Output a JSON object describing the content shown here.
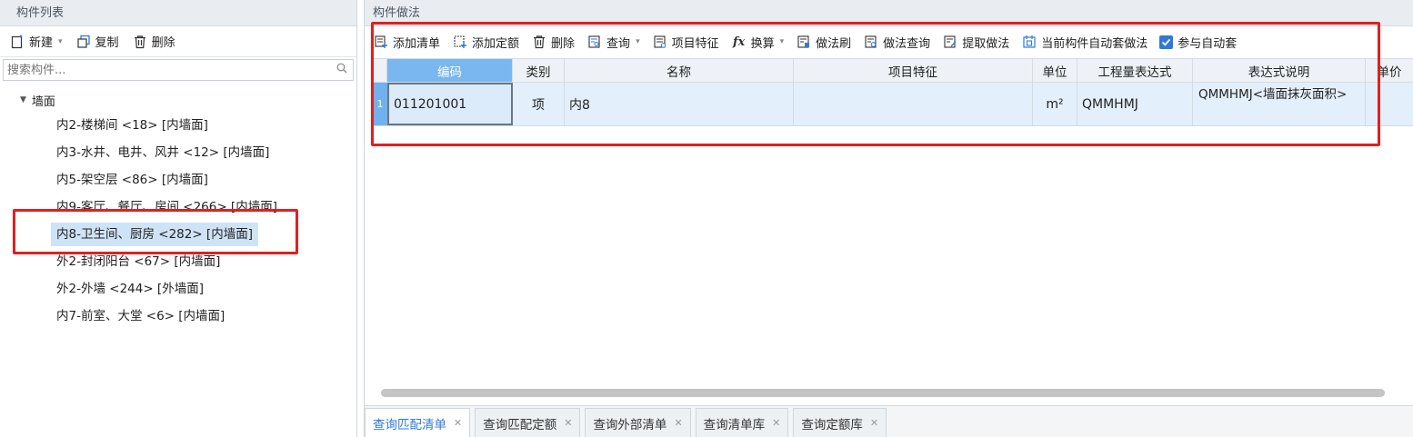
{
  "left_panel": {
    "title": "构件列表",
    "toolbar": {
      "new_label": "新建",
      "copy_label": "复制",
      "delete_label": "删除"
    },
    "search": {
      "placeholder": "搜索构件..."
    },
    "tree": {
      "root_label": "墙面",
      "items": [
        {
          "label": "内2-楼梯间 <18> [内墙面]"
        },
        {
          "label": "内3-水井、电井、风井 <12> [内墙面]"
        },
        {
          "label": "内5-架空层 <86> [内墙面]"
        },
        {
          "label": "内9-客厅、餐厅、房间 <266> [内墙面]"
        },
        {
          "label": "内8-卫生间、厨房 <282> [内墙面]",
          "selected": true
        },
        {
          "label": "外2-封闭阳台 <67> [内墙面]"
        },
        {
          "label": "外2-外墙 <244> [外墙面]"
        },
        {
          "label": "内7-前室、大堂 <6> [内墙面]"
        }
      ]
    }
  },
  "right_panel": {
    "title": "构件做法",
    "toolbar": {
      "add_list": "添加清单",
      "add_quota": "添加定额",
      "delete": "删除",
      "query": "查询",
      "item_feature": "项目特征",
      "convert": "换算",
      "method_brush": "做法刷",
      "method_query": "做法查询",
      "extract_method": "提取做法",
      "auto_apply": "当前构件自动套做法",
      "participate_auto": "参与自动套"
    },
    "grid": {
      "columns": [
        "编码",
        "类别",
        "名称",
        "项目特征",
        "单位",
        "工程量表达式",
        "表达式说明",
        "单价"
      ],
      "rows": [
        {
          "num": "1",
          "code": "011201001",
          "category": "项",
          "name": "内8",
          "feature": "",
          "unit": "m²",
          "expression": "QMMHMJ",
          "expr_desc": "QMMHMJ<墙面抹灰面积>",
          "price": ""
        }
      ]
    },
    "bottom_tabs": [
      {
        "label": "查询匹配清单",
        "active": true
      },
      {
        "label": "查询匹配定额"
      },
      {
        "label": "查询外部清单"
      },
      {
        "label": "查询清单库"
      },
      {
        "label": "查询定额库"
      }
    ]
  },
  "colors": {
    "selection_blue": "#cfe3f6",
    "header_active": "#7ab6ef",
    "highlight_red": "#e02020",
    "accent_blue": "#2f7ad8"
  }
}
